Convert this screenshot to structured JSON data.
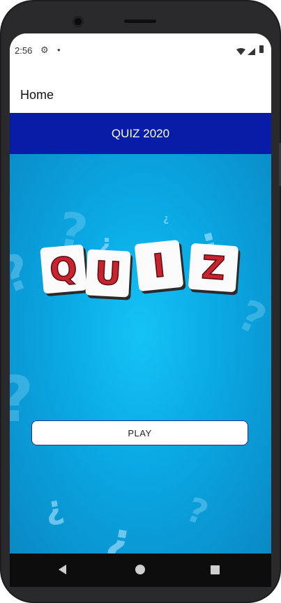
{
  "status_bar": {
    "time": "2:56",
    "icons": [
      "settings-icon",
      "notification-dot-icon",
      "wifi-icon",
      "signal-icon",
      "battery-icon"
    ]
  },
  "app_bar": {
    "title": "Home"
  },
  "header": {
    "title": "QUIZ 2020",
    "background_color": "#081ca6"
  },
  "logo": {
    "letters": [
      "Q",
      "U",
      "I",
      "Z"
    ],
    "letter_color": "#c8242f"
  },
  "play_button": {
    "label": "PLAY"
  },
  "nav_bar": {
    "buttons": [
      "back-icon",
      "home-icon",
      "recents-icon"
    ]
  },
  "colors": {
    "content_background": "#0aa7e3"
  }
}
